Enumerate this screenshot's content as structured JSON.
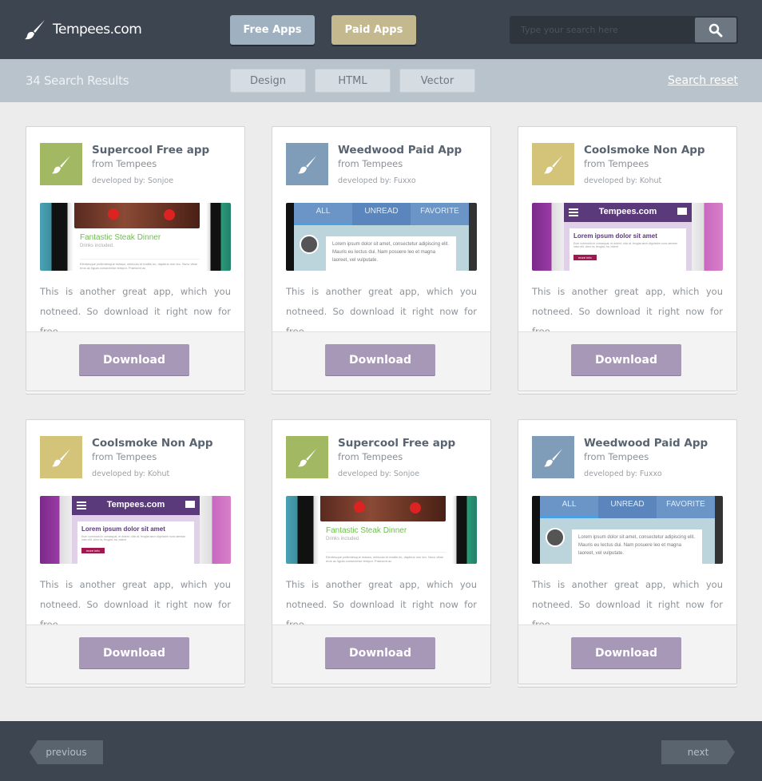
{
  "header": {
    "logo_text": "Tempees.com",
    "free_apps": "Free Apps",
    "paid_apps": "Paid Apps",
    "search_placeholder": "Type your search here",
    "search_icon": "search-icon"
  },
  "subheader": {
    "results": "34 Search Results",
    "filters": [
      "Design",
      "HTML",
      "Vector"
    ],
    "reset": "Search reset"
  },
  "colors": {
    "green": "#a3b863",
    "blue": "#7f9cb8",
    "yellow": "#d3c47a",
    "download": "#a898b8"
  },
  "mocks": {
    "food": {
      "title": "Fantastic Steak Dinner",
      "subtitle": "Drinks included.",
      "body": "Elentesque pellentesque massa, vehicula et mattis eu, dapibus non leo. Nunc vitae eros ac ligula consectetur tempor. Praesent ac"
    },
    "chat": {
      "tabs": [
        "ALL",
        "UNREAD",
        "FAVORITE"
      ],
      "body": "Lorem ipsum dolor sit amet, consectetur adipiscing elit. Mauris eu lectus dui. Nam posuere leo et magna laoreet, vel vulputate."
    },
    "purple": {
      "brand": "Tempees.com",
      "heading": "Lorem ipsum dolor sit amet",
      "body": "Eum commodo in consequat, et dolent, odio at, feugiat aeon dignissim nunc aenean iusto elit, viero ta, feugiat, ba, dolent",
      "button": "more info"
    }
  },
  "cards": [
    {
      "title": "Supercool Free app",
      "from": "from Tempees",
      "developer": "developed by: Sonjoe",
      "color": "#a3b863",
      "mock": "food",
      "description": "This is another great app, which you notneed. So download it right now for free.",
      "button": "Download"
    },
    {
      "title": "Weedwood Paid App",
      "from": "from Tempees",
      "developer": "developed by: Fuxxo",
      "color": "#7f9cb8",
      "mock": "chat",
      "description": "This is another great app, which you notneed. So download it right now for free.",
      "button": "Download"
    },
    {
      "title": "Coolsmoke Non App",
      "from": "from Tempees",
      "developer": "developed by: Kohut",
      "color": "#d3c47a",
      "mock": "purple",
      "description": "This is another great app, which you notneed. So download it right now for free.",
      "button": "Download"
    },
    {
      "title": "Coolsmoke Non App",
      "from": "from Tempees",
      "developer": "developed by: Kohut",
      "color": "#d3c47a",
      "mock": "purple",
      "description": "This is another great app, which you notneed. So download it right now for free.",
      "button": "Download"
    },
    {
      "title": "Supercool Free app",
      "from": "from Tempees",
      "developer": "developed by: Sonjoe",
      "color": "#a3b863",
      "mock": "food",
      "description": "This is another great app, which you notneed. So download it right now for free.",
      "button": "Download"
    },
    {
      "title": "Weedwood Paid App",
      "from": "from Tempees",
      "developer": "developed by: Fuxxo",
      "color": "#7f9cb8",
      "mock": "chat",
      "description": "This is another great app, which you notneed. So download it right now for free.",
      "button": "Download"
    }
  ],
  "pagination": {
    "previous": "previous",
    "next": "next"
  }
}
